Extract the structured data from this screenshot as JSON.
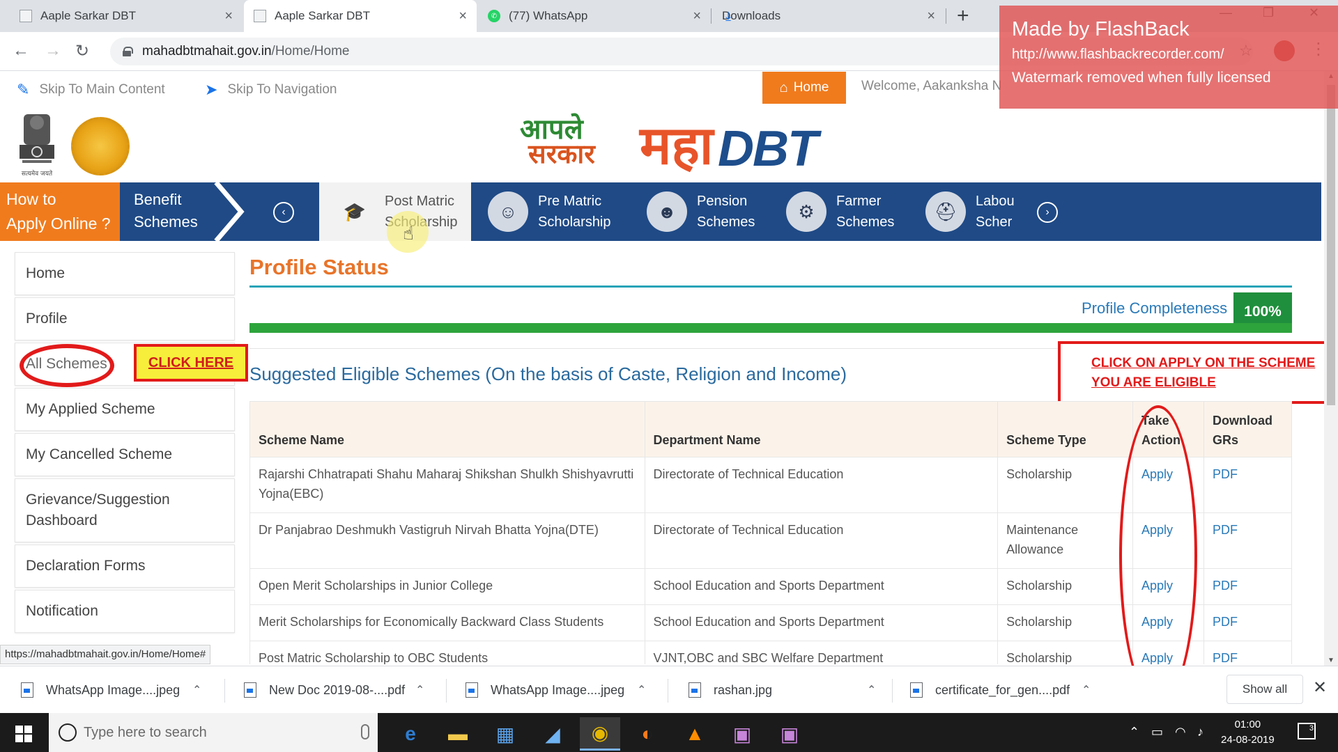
{
  "browser": {
    "tabs": [
      {
        "title": "Aaple Sarkar DBT",
        "icon": "document-icon"
      },
      {
        "title": "Aaple Sarkar DBT",
        "icon": "document-icon"
      },
      {
        "title": "(77) WhatsApp",
        "icon": "whatsapp-icon"
      },
      {
        "title": "Downloads",
        "icon": "download-icon"
      }
    ],
    "url_host": "mahadbtmahait.gov.in",
    "url_path": "/Home/Home",
    "status_url": "https://mahadbtmahait.gov.in/Home/Home#"
  },
  "watermark": {
    "line1": "Made by FlashBack",
    "line2": "http://www.flashbackrecorder.com/",
    "line3": "Watermark removed when fully licensed"
  },
  "accessibility": {
    "skip_main": "Skip To Main Content",
    "skip_nav": "Skip To Navigation"
  },
  "header": {
    "home_label": "Home",
    "welcome": "Welcome, Aakanksha N",
    "logo_aaple_1": "आपले",
    "logo_aaple_2": "सरकार",
    "logo_maha": "महा",
    "logo_dbt": "DBT",
    "emblem_motto": "सत्यमेव जयते"
  },
  "nav": {
    "howto_1": "How to",
    "howto_2": "Apply Online ?",
    "benefit_1": "Benefit",
    "benefit_2": "Schemes",
    "tabs": [
      {
        "line1": "Post Matric",
        "line2": "Scholarship",
        "icon": "graduation-cap-icon"
      },
      {
        "line1": "Pre Matric",
        "line2": "Scholarship",
        "icon": "student-icon"
      },
      {
        "line1": "Pension",
        "line2": "Schemes",
        "icon": "elderly-person-icon"
      },
      {
        "line1": "Farmer",
        "line2": "Schemes",
        "icon": "tractor-icon"
      },
      {
        "line1": "Labou",
        "line2": "Scher",
        "icon": "worker-helmet-icon"
      }
    ]
  },
  "sidebar": {
    "items": [
      "Home",
      "Profile",
      "All Schemes",
      "My Applied Scheme",
      "My Cancelled Scheme",
      "Grievance/Suggestion Dashboard",
      "Declaration Forms",
      "Notification"
    ]
  },
  "annotations": {
    "click_here": "CLICK HERE",
    "apply_note_1": "CLICK ON APPLY ON THE SCHEME",
    "apply_note_2": "YOU ARE ELIGIBLE"
  },
  "profile": {
    "title": "Profile Status",
    "completeness_label": "Profile Completeness",
    "completeness_value": "100%",
    "completeness_fraction": 1.0
  },
  "schemes": {
    "heading": "Suggested Eligible Schemes (On the basis of Caste, Religion and Income)",
    "columns": [
      "Scheme Name",
      "Department Name",
      "Scheme Type",
      "Take Action",
      "Download GRs"
    ],
    "rows": [
      {
        "name": "Rajarshi Chhatrapati Shahu Maharaj Shikshan Shulkh Shishyavrutti Yojna(EBC)",
        "dept": "Directorate of Technical Education",
        "type": "Scholarship",
        "action": "Apply",
        "gr": "PDF"
      },
      {
        "name": "Dr Panjabrao Deshmukh Vastigruh Nirvah Bhatta Yojna(DTE)",
        "dept": "Directorate of Technical Education",
        "type": "Maintenance Allowance",
        "action": "Apply",
        "gr": "PDF"
      },
      {
        "name": "Open Merit Scholarships in Junior College",
        "dept": "School Education and Sports Department",
        "type": "Scholarship",
        "action": "Apply",
        "gr": "PDF"
      },
      {
        "name": "Merit Scholarships for Economically Backward Class Students",
        "dept": "School Education and Sports Department",
        "type": "Scholarship",
        "action": "Apply",
        "gr": "PDF"
      },
      {
        "name": "Post Matric Scholarship to OBC Students",
        "dept": "VJNT,OBC and SBC Welfare Department",
        "type": "Scholarship",
        "action": "Apply",
        "gr": "PDF"
      }
    ]
  },
  "downloads": {
    "items": [
      "WhatsApp Image....jpeg",
      "New Doc 2019-08-....pdf",
      "WhatsApp Image....jpeg",
      "rashan.jpg",
      "certificate_for_gen....pdf"
    ],
    "show_all": "Show all"
  },
  "taskbar": {
    "search_placeholder": "Type here to search",
    "time": "01:00",
    "date": "24-08-2019",
    "notification_count": "3"
  }
}
